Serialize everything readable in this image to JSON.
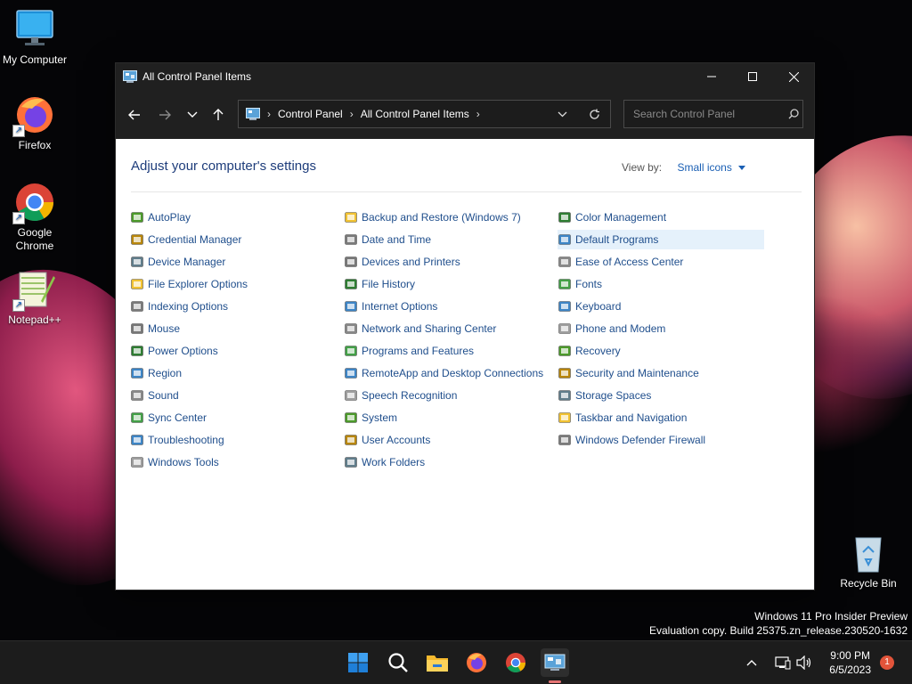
{
  "desktop": {
    "icons": [
      {
        "label": "My Computer"
      },
      {
        "label": "Firefox"
      },
      {
        "label": "Google Chrome"
      },
      {
        "label": "Notepad++"
      },
      {
        "label": "Recycle Bin"
      }
    ]
  },
  "window": {
    "title": "All Control Panel Items",
    "controls": {
      "minimize": "minimize-icon",
      "maximize": "maximize-icon",
      "close": "close-icon"
    }
  },
  "address_bar": {
    "crumbs": [
      "Control Panel",
      "All Control Panel Items"
    ]
  },
  "search": {
    "placeholder": "Search Control Panel"
  },
  "content": {
    "heading": "Adjust your computer's settings",
    "view_by_label": "View by:",
    "view_by_value": "Small icons",
    "columns": [
      [
        "AutoPlay",
        "Credential Manager",
        "Device Manager",
        "File Explorer Options",
        "Indexing Options",
        "Mouse",
        "Power Options",
        "Region",
        "Sound",
        "Sync Center",
        "Troubleshooting",
        "Windows Tools"
      ],
      [
        "Backup and Restore (Windows 7)",
        "Date and Time",
        "Devices and Printers",
        "File History",
        "Internet Options",
        "Network and Sharing Center",
        "Programs and Features",
        "RemoteApp and Desktop Connections",
        "Speech Recognition",
        "System",
        "User Accounts",
        "Work Folders"
      ],
      [
        "Color Management",
        "Default Programs",
        "Ease of Access Center",
        "Fonts",
        "Keyboard",
        "Phone and Modem",
        "Recovery",
        "Security and Maintenance",
        "Storage Spaces",
        "Taskbar and Navigation",
        "Windows Defender Firewall"
      ]
    ],
    "highlighted": "Default Programs"
  },
  "watermark": {
    "line1": "Windows 11 Pro Insider Preview",
    "line2": "Evaluation copy. Build 25375.zn_release.230520-1632"
  },
  "taskbar": {
    "time": "9:00 PM",
    "date": "6/5/2023",
    "notification_count": "1"
  }
}
